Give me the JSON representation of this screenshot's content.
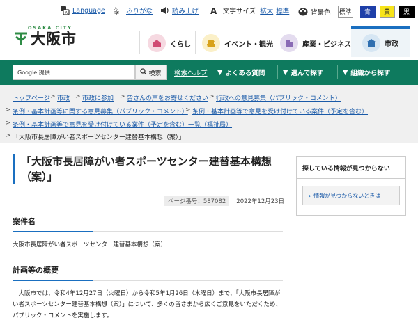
{
  "util": {
    "language": "Language",
    "furigana": "ふりがな",
    "read_aloud": "読み上げ",
    "font_size_label": "文字サイズ",
    "font_larger": "拡大",
    "font_standard": "標準",
    "bg_label": "背景色",
    "bg_standard": "標準",
    "bg_blue": "青",
    "bg_yellow": "黄",
    "bg_black": "黒"
  },
  "header": {
    "logo_sub": "OSAKA CITY",
    "logo_text": "大阪市",
    "nav": [
      {
        "label": "くらし"
      },
      {
        "label": "イベント・観光"
      },
      {
        "label": "産業・ビジネス"
      },
      {
        "label": "市政"
      }
    ]
  },
  "greenbar": {
    "search_placeholder": "Google 提供",
    "search_button": "検索",
    "help": "検索ヘルプ",
    "faq": "よくある質問",
    "choose": "選んで探す",
    "org": "組織から探す"
  },
  "breadcrumb": {
    "items": [
      "トップページ",
      "市政",
      "市政に参加",
      "皆さんの声をお寄せください",
      "行政への意見募集（パブリック・コメント）",
      "条例・基本計画等に関する意見募集（パブリック・コメント）",
      "条例・基本計画等で意見を受け付けている案件（予定を含む）",
      "条例・基本計画等で意見を受け付けている案件（予定を含む）一覧（福祉局）"
    ],
    "current": "「大阪市長居障がい者スポーツセンター建替基本構想（案）」"
  },
  "page": {
    "title_line1": "「大阪市長居障がい者スポーツセンター建替基本構想",
    "title_line2": "（案）」",
    "page_id": "ページ番号：587082",
    "date": "2022年12月23日"
  },
  "sections": {
    "case_heading": "案件名",
    "case_text": "大阪市長居障がい者スポーツセンター建替基本構想（案）",
    "plan_heading": "計画等の概要",
    "plan_text": "　大阪市では、令和4年12月27日（火曜日）から令和5年1月26日（木曜日）まで、「大阪市長居障がい者スポーツセンター建替基本構想（案）」について、多くの皆さまから広くご意見をいただくため、パブリック・コメントを実施します。"
  },
  "side": {
    "heading": "探している情報が見つからない",
    "button": "情報が見つからないときは"
  }
}
